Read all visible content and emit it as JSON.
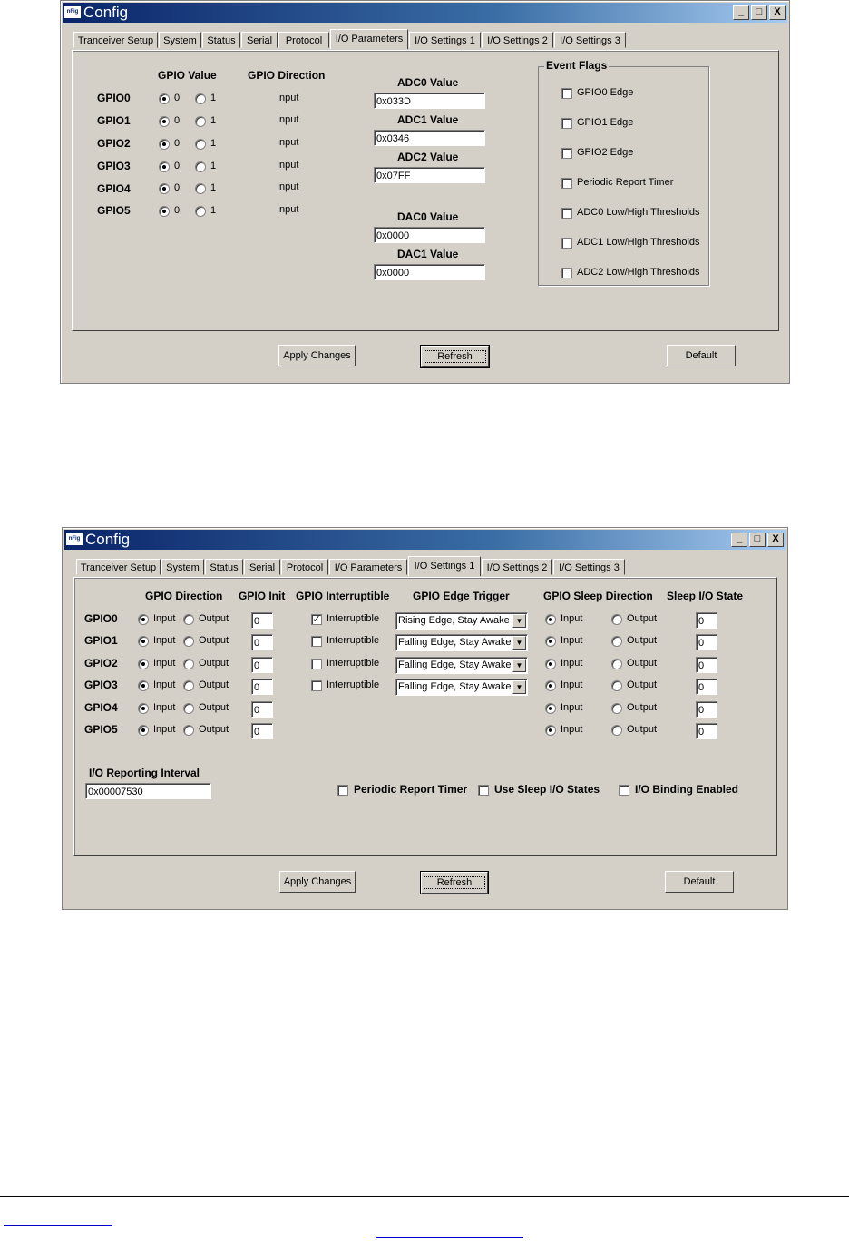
{
  "window": {
    "title": "Config",
    "app_icon_text": "nFig",
    "minimize": "_",
    "maximize": "□",
    "close": "X"
  },
  "tabs": [
    "Tranceiver Setup",
    "System",
    "Status",
    "Serial",
    "Protocol",
    "I/O Parameters",
    "I/O Settings 1",
    "I/O Settings 2",
    "I/O Settings 3"
  ],
  "buttons": {
    "apply": "Apply Changes",
    "refresh": "Refresh",
    "default": "Default"
  },
  "screen1": {
    "active_tab": "I/O Parameters",
    "headers": {
      "gpio_value": "GPIO Value",
      "gpio_direction": "GPIO Direction"
    },
    "radio_labels": {
      "zero": "0",
      "one": "1"
    },
    "gpio_rows": [
      {
        "name": "GPIO0",
        "value": "0",
        "direction": "Input"
      },
      {
        "name": "GPIO1",
        "value": "0",
        "direction": "Input"
      },
      {
        "name": "GPIO2",
        "value": "0",
        "direction": "Input"
      },
      {
        "name": "GPIO3",
        "value": "0",
        "direction": "Input"
      },
      {
        "name": "GPIO4",
        "value": "0",
        "direction": "Input"
      },
      {
        "name": "GPIO5",
        "value": "0",
        "direction": "Input"
      }
    ],
    "analog": [
      {
        "label": "ADC0 Value",
        "value": "0x033D"
      },
      {
        "label": "ADC1 Value",
        "value": "0x0346"
      },
      {
        "label": "ADC2 Value",
        "value": "0x07FF"
      },
      {
        "label": "DAC0 Value",
        "value": "0x0000"
      },
      {
        "label": "DAC1 Value",
        "value": "0x0000"
      }
    ],
    "event_flags": {
      "title": "Event Flags",
      "items": [
        {
          "label": "GPIO0 Edge",
          "checked": false
        },
        {
          "label": "GPIO1 Edge",
          "checked": false
        },
        {
          "label": "GPIO2 Edge",
          "checked": false
        },
        {
          "label": "Periodic Report Timer",
          "checked": false
        },
        {
          "label": "ADC0 Low/High Thresholds",
          "checked": false
        },
        {
          "label": "ADC1 Low/High Thresholds",
          "checked": false
        },
        {
          "label": "ADC2 Low/High Thresholds",
          "checked": false
        }
      ]
    }
  },
  "screen2": {
    "active_tab": "I/O Settings 1",
    "headers": {
      "gpio_direction": "GPIO Direction",
      "gpio_init": "GPIO Init",
      "gpio_interruptible": "GPIO Interruptible",
      "gpio_edge_trigger": "GPIO Edge Trigger",
      "gpio_sleep_direction": "GPIO Sleep Direction",
      "sleep_io_state": "Sleep I/O State"
    },
    "radio_labels": {
      "input": "Input",
      "output": "Output"
    },
    "interruptible_label": "Interruptible",
    "gpio_rows": [
      {
        "name": "GPIO0",
        "direction": "Input",
        "init": "0",
        "interruptible": true,
        "edge_trigger": "Rising Edge, Stay Awake",
        "sleep_direction": "Input",
        "sleep_state": "0"
      },
      {
        "name": "GPIO1",
        "direction": "Input",
        "init": "0",
        "interruptible": false,
        "edge_trigger": "Falling Edge, Stay Awake",
        "sleep_direction": "Input",
        "sleep_state": "0"
      },
      {
        "name": "GPIO2",
        "direction": "Input",
        "init": "0",
        "interruptible": false,
        "edge_trigger": "Falling Edge, Stay Awake",
        "sleep_direction": "Input",
        "sleep_state": "0"
      },
      {
        "name": "GPIO3",
        "direction": "Input",
        "init": "0",
        "interruptible": false,
        "edge_trigger": "Falling Edge, Stay Awake",
        "sleep_direction": "Input",
        "sleep_state": "0"
      },
      {
        "name": "GPIO4",
        "direction": "Input",
        "init": "0",
        "sleep_direction": "Input",
        "sleep_state": "0"
      },
      {
        "name": "GPIO5",
        "direction": "Input",
        "init": "0",
        "sleep_direction": "Input",
        "sleep_state": "0"
      }
    ],
    "reporting_interval": {
      "label": "I/O Reporting Interval",
      "value": "0x00007530"
    },
    "options": [
      {
        "label": "Periodic Report Timer",
        "checked": false
      },
      {
        "label": "Use Sleep I/O States",
        "checked": false
      },
      {
        "label": "I/O Binding Enabled",
        "checked": false
      }
    ]
  }
}
